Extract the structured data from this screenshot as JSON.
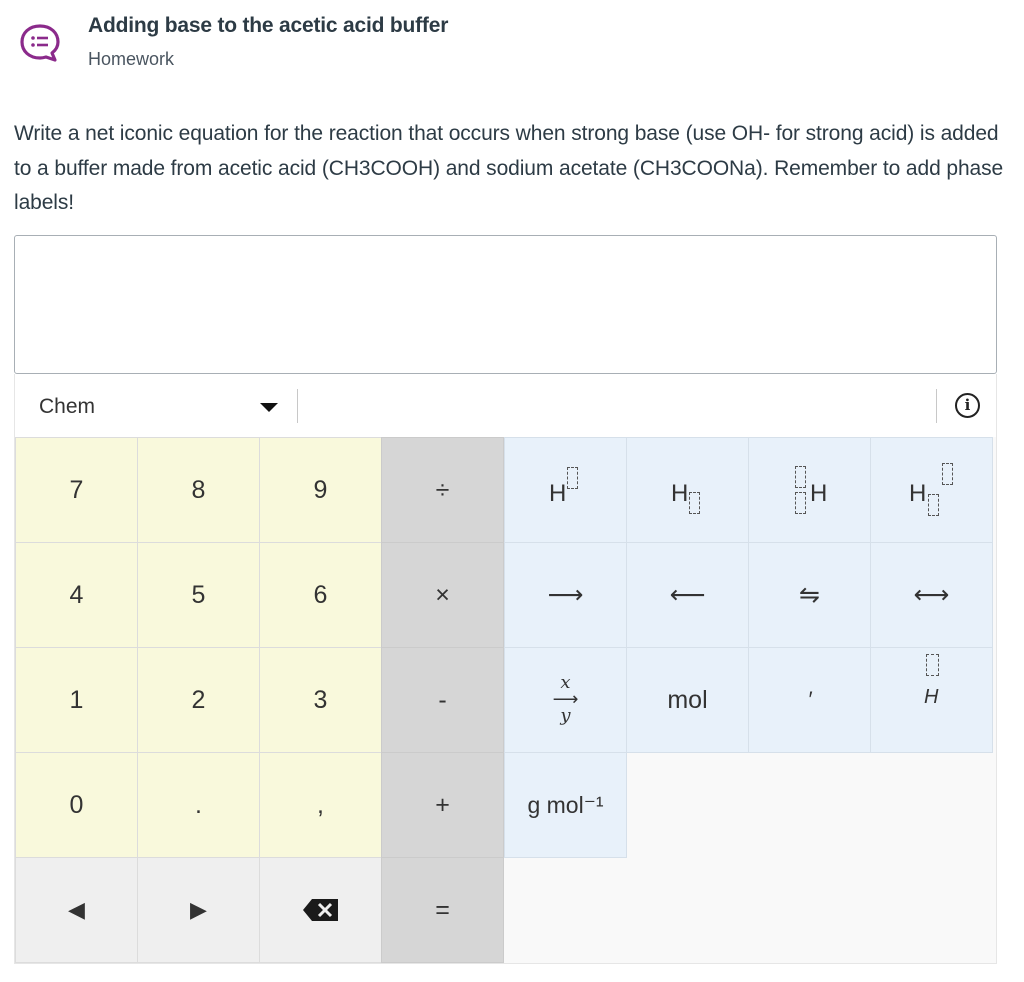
{
  "header": {
    "icon": "chat-list-icon",
    "title": "Adding base to the acetic acid buffer",
    "subtitle": "Homework"
  },
  "question": {
    "text": "Write a net iconic equation for the reaction that occurs when strong base (use OH- for strong acid) is added to a buffer made from acetic acid (CH3COOH) and sodium acetate (CH3COONa). Remember to add phase labels!"
  },
  "answer": {
    "value": ""
  },
  "toolbar": {
    "mode": "Chem",
    "info_icon": "info-icon"
  },
  "keypad": {
    "digits": {
      "seven": "7",
      "eight": "8",
      "nine": "9",
      "four": "4",
      "five": "5",
      "six": "6",
      "one": "1",
      "two": "2",
      "three": "3",
      "zero": "0",
      "point": ".",
      "comma": ","
    },
    "operators": {
      "divide": "÷",
      "multiply": "×",
      "minus": "-",
      "plus": "+",
      "equals": "="
    },
    "chem": {
      "H": "H",
      "arrow_right": "⟶",
      "arrow_left": "⟵",
      "equilibrium": "⇋",
      "resonance": "⟷",
      "frac_x": "x",
      "frac_arrow": "⟶",
      "frac_y": "y",
      "mol": "mol",
      "prime": "′",
      "enthalpy_H": "H",
      "g_mol": "g mol⁻¹"
    },
    "nav": {
      "left": "◀",
      "right": "▶",
      "backspace_icon": "backspace-icon"
    }
  }
}
